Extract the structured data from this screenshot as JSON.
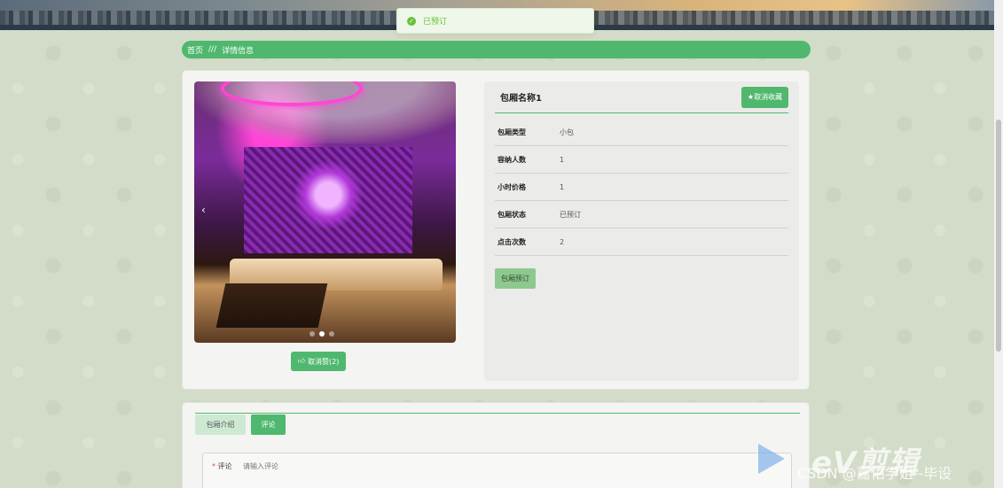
{
  "toast": {
    "text": "已预订",
    "icon": "check-circle-icon",
    "color": "#67c23a"
  },
  "breadcrumb": {
    "home": "首页",
    "separator": "///",
    "current": "详情信息"
  },
  "carousel": {
    "slide_count": 3,
    "active_index": 1
  },
  "like_button": {
    "label": "取消赞(2)",
    "icon": "thumbs-up-icon"
  },
  "detail": {
    "title": "包厢名称1",
    "favorite_button": "★取消收藏",
    "rows": [
      {
        "label": "包厢类型",
        "value": "小包"
      },
      {
        "label": "容纳人数",
        "value": "1"
      },
      {
        "label": "小时价格",
        "value": "1"
      },
      {
        "label": "包厢状态",
        "value": "已预订"
      },
      {
        "label": "点击次数",
        "value": "2"
      }
    ],
    "book_button": "包厢预订"
  },
  "tabs": {
    "intro": "包厢介绍",
    "comment": "评论"
  },
  "comment_form": {
    "label": "评论",
    "placeholder": "请输入评论"
  },
  "watermark": {
    "brand": "eV剪辑",
    "credit": "CSDN @嘉佑学姐--毕设"
  },
  "colors": {
    "accent": "#4fb86e",
    "accent_light": "#8dc98f",
    "background": "#d3dcc8"
  }
}
